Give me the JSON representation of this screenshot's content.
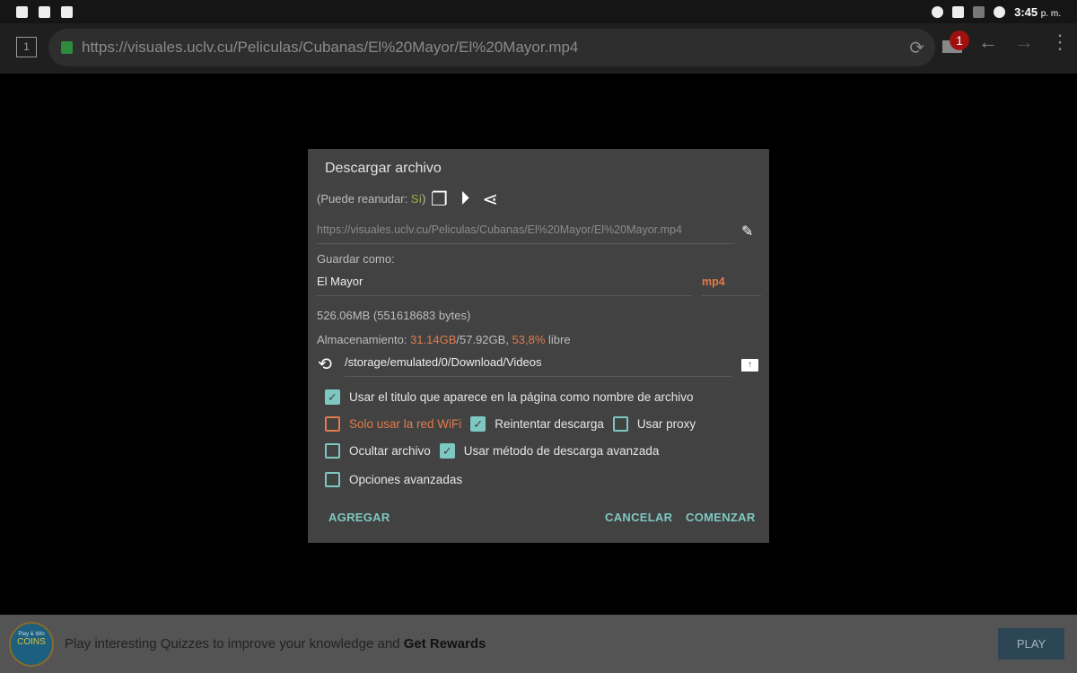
{
  "status": {
    "time": "3:45",
    "ampm": "p. m."
  },
  "browser": {
    "tab_count": "1",
    "url": "https://visuales.uclv.cu/Peliculas/Cubanas/El%20Mayor/El%20Mayor.mp4",
    "download_badge": "1"
  },
  "dialog": {
    "title": "Descargar archivo",
    "resume_prefix": "(Puede reanudar: ",
    "resume_value": "Sí",
    "resume_suffix": ")",
    "url": "https://visuales.uclv.cu/Peliculas/Cubanas/El%20Mayor/El%20Mayor.mp4",
    "save_as_label": "Guardar como:",
    "filename": "El Mayor",
    "extension": "mp4",
    "size": "526.06MB (551618683 bytes)",
    "storage_label": "Almacenamiento: ",
    "storage_used": "31.14GB",
    "storage_total": "/57.92GB, ",
    "storage_free_pct": "53,8%",
    "storage_free_label": " libre",
    "path": "/storage/emulated/0/Download/Videos",
    "options": [
      {
        "label": "Usar el titulo que aparece en la página como nombre de archivo",
        "checked": true
      },
      {
        "label": "Solo usar la red WiFi",
        "checked": false
      },
      {
        "label": "Reintentar descarga",
        "checked": true
      },
      {
        "label": "Usar proxy",
        "checked": false
      },
      {
        "label": "Ocultar archivo",
        "checked": false
      },
      {
        "label": "Usar método de descarga avanzada",
        "checked": true
      },
      {
        "label": "Opciones avanzadas",
        "checked": false
      }
    ],
    "add": "AGREGAR",
    "cancel": "CANCELAR",
    "start": "COMENZAR"
  },
  "ad": {
    "logo_top": "Play & Win",
    "logo_main": "COINS",
    "text": "Play interesting Quizzes to improve your knowledge and ",
    "text_bold": "Get Rewards",
    "button": "PLAY"
  },
  "colors": {
    "accent": "#7ec8c2",
    "warning": "#e27a4a",
    "dialog_bg": "#424242"
  }
}
